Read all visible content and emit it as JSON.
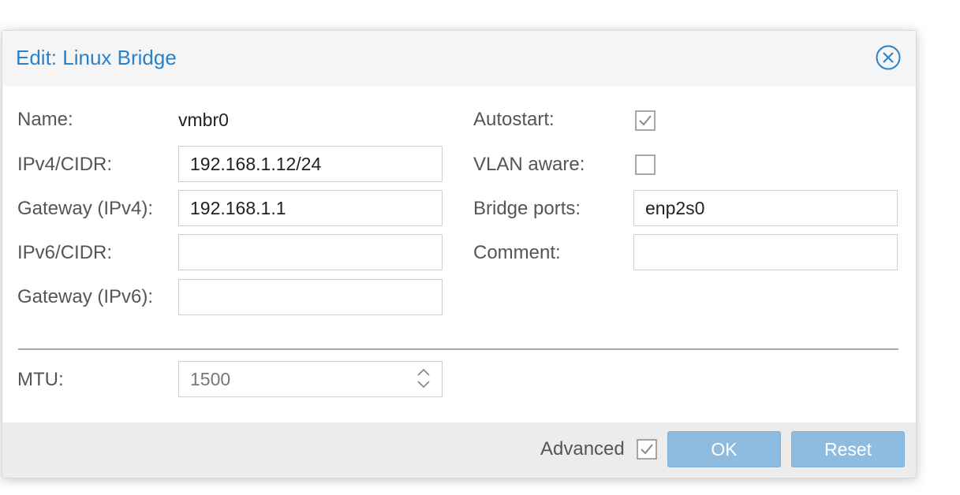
{
  "dialog": {
    "title": "Edit: Linux Bridge"
  },
  "fields": {
    "name_label": "Name:",
    "name_value": "vmbr0",
    "ipv4_label": "IPv4/CIDR:",
    "ipv4_value": "192.168.1.12/24",
    "gateway4_label": "Gateway (IPv4):",
    "gateway4_value": "192.168.1.1",
    "ipv6_label": "IPv6/CIDR:",
    "ipv6_value": "",
    "gateway6_label": "Gateway (IPv6):",
    "gateway6_value": "",
    "autostart_label": "Autostart:",
    "autostart_checked": true,
    "vlan_label": "VLAN aware:",
    "vlan_checked": false,
    "bridge_ports_label": "Bridge ports:",
    "bridge_ports_value": "enp2s0",
    "comment_label": "Comment:",
    "comment_value": "",
    "mtu_label": "MTU:",
    "mtu_value": "1500"
  },
  "footer": {
    "advanced_label": "Advanced",
    "advanced_checked": true,
    "ok_label": "OK",
    "reset_label": "Reset"
  },
  "colors": {
    "title": "#2a82cc",
    "button_bg": "#8dbce0",
    "footer_bg": "#ececec",
    "header_bg": "#f5f5f5"
  },
  "icons": {
    "close": "close-circle-icon",
    "checkbox_checked": "checkmark-icon",
    "spinner": "spinner-arrows-icon"
  }
}
